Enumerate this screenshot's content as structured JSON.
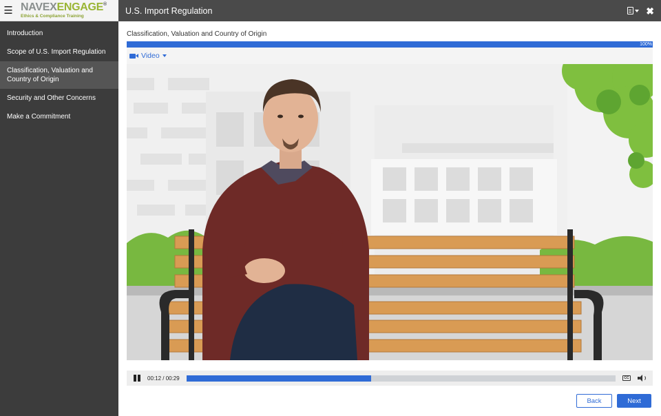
{
  "header": {
    "logo_navex": "NAVEX",
    "logo_engage": "ENGAGE",
    "logo_reg": "®",
    "logo_tagline": "Ethics & Compliance Training",
    "course_title": "U.S. Import Regulation",
    "menu_icon": "hamburger-icon",
    "document_icon": "document-icon",
    "close_icon": "close-icon"
  },
  "sidebar": {
    "items": [
      {
        "label": "Introduction",
        "active": false
      },
      {
        "label": "Scope of U.S. Import Regulation",
        "active": false
      },
      {
        "label": "Classification, Valuation and Country of Origin",
        "active": true
      },
      {
        "label": "Security and Other Concerns",
        "active": false
      },
      {
        "label": "Make a Commitment",
        "active": false
      }
    ]
  },
  "main": {
    "page_title": "Classification, Valuation and Country of Origin",
    "progress": {
      "value": 1.0,
      "label": "100%"
    },
    "media_selector": {
      "label": "Video",
      "icon": "video-camera-icon"
    }
  },
  "player": {
    "timecode": "00:12 / 00:29",
    "played_fraction": 0.43,
    "pause_icon": "pause-icon",
    "cc_label": "CC",
    "cc_icon": "closed-captions-icon",
    "volume_icon": "volume-icon"
  },
  "navigation": {
    "back_label": "Back",
    "next_label": "Next"
  },
  "colors": {
    "accent": "#2f6bd6",
    "titlebar": "#4a4a4a",
    "sidebar": "#3c3c3c",
    "sidebar_active": "#555555",
    "brand_green": "#9ab534"
  }
}
